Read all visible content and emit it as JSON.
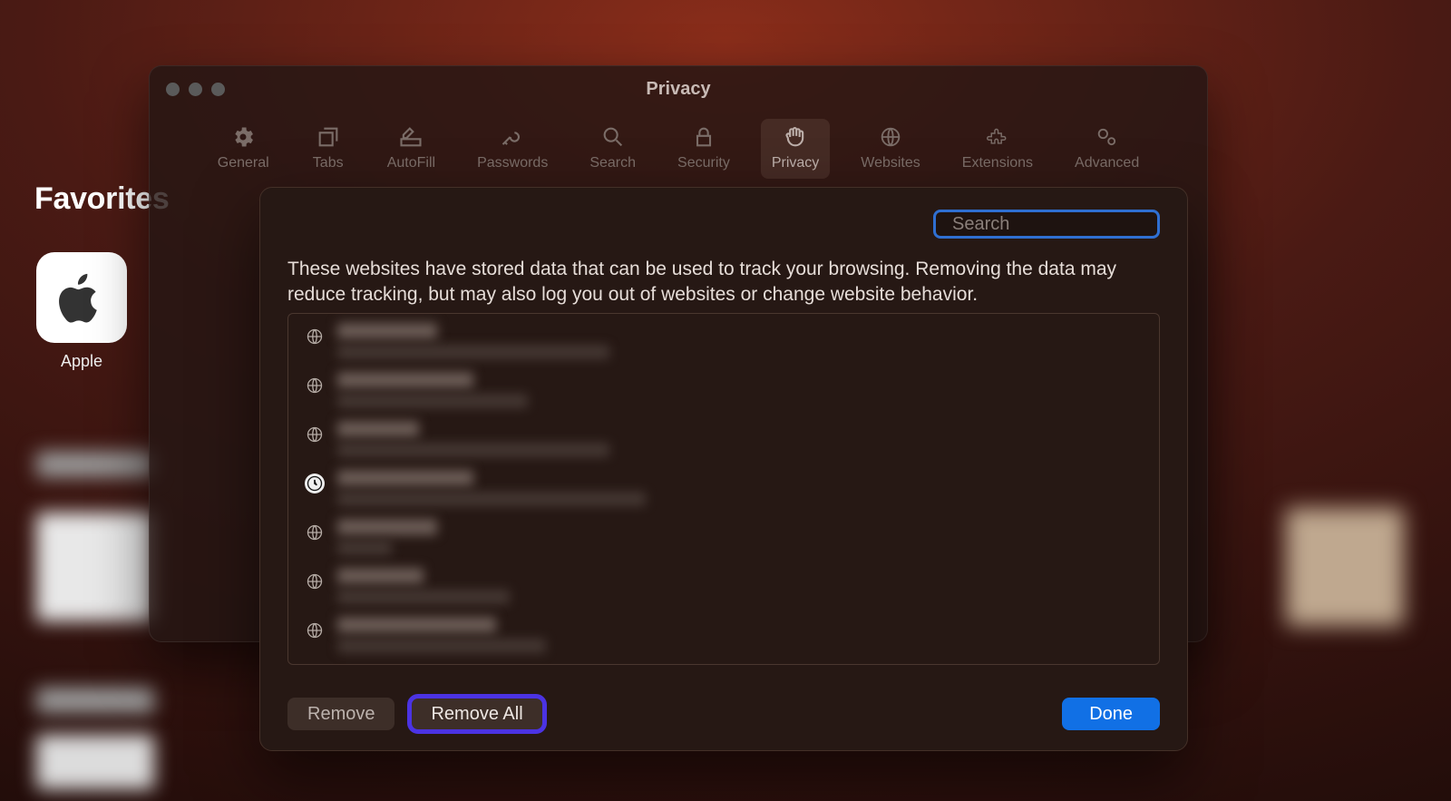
{
  "favorites": {
    "heading": "Favorites",
    "items": [
      {
        "label": "Apple",
        "icon": "apple-logo"
      }
    ]
  },
  "prefs_window": {
    "title": "Privacy",
    "tabs": [
      {
        "id": "general",
        "label": "General"
      },
      {
        "id": "tabs",
        "label": "Tabs"
      },
      {
        "id": "autofill",
        "label": "AutoFill"
      },
      {
        "id": "passwords",
        "label": "Passwords"
      },
      {
        "id": "search",
        "label": "Search"
      },
      {
        "id": "security",
        "label": "Security"
      },
      {
        "id": "privacy",
        "label": "Privacy",
        "active": true
      },
      {
        "id": "websites",
        "label": "Websites"
      },
      {
        "id": "extensions",
        "label": "Extensions"
      },
      {
        "id": "advanced",
        "label": "Advanced"
      }
    ],
    "details_button": "...",
    "help_button": "?"
  },
  "sheet": {
    "search_placeholder": "Search",
    "description": "These websites have stored data that can be used to track your browsing. Removing the data may reduce tracking, but may also log you out of websites or change website behavior.",
    "sites": [
      {
        "icon": "globe",
        "domain_redacted": true
      },
      {
        "icon": "globe",
        "domain_redacted": true
      },
      {
        "icon": "globe",
        "domain_redacted": true
      },
      {
        "icon": "clock",
        "domain_redacted": true
      },
      {
        "icon": "globe",
        "domain_redacted": true
      },
      {
        "icon": "globe",
        "domain_redacted": true
      },
      {
        "icon": "globe",
        "domain_redacted": true
      }
    ],
    "buttons": {
      "remove": "Remove",
      "remove_all": "Remove All",
      "done": "Done"
    },
    "highlighted_button": "remove_all"
  }
}
